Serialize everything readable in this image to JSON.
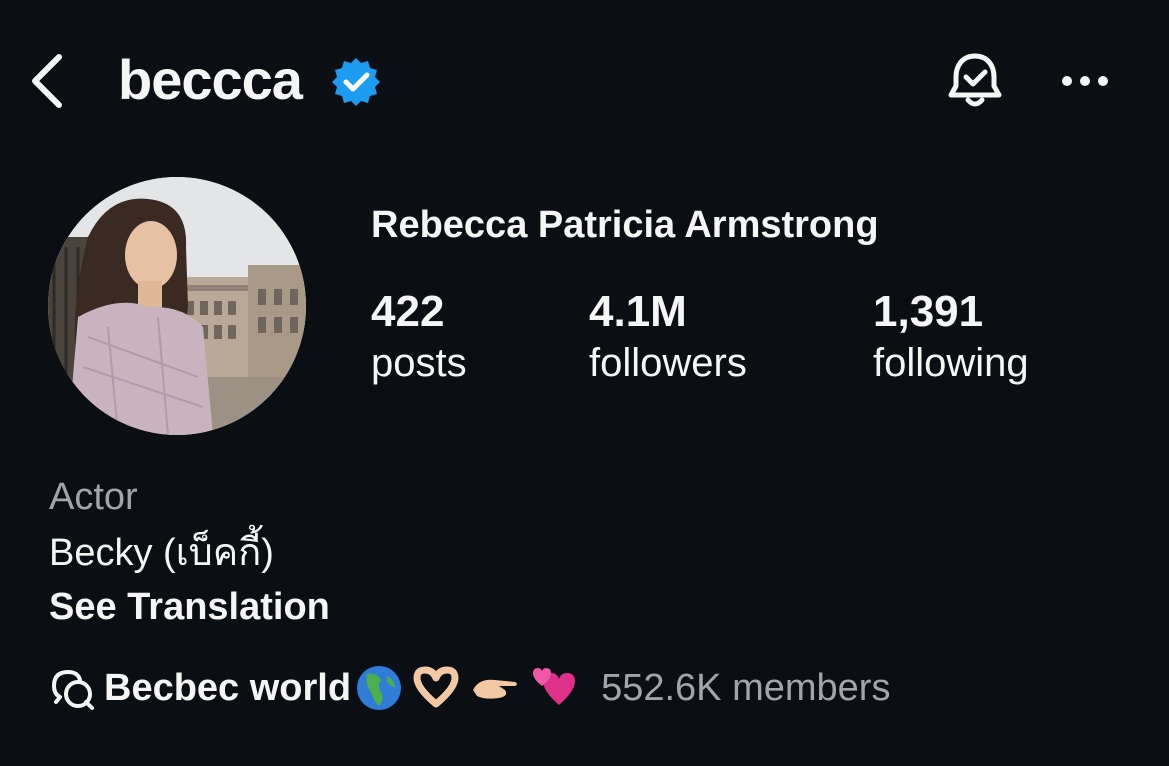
{
  "header": {
    "username": "beccca",
    "verified_color": "#1d9bf0"
  },
  "profile": {
    "full_name": "Rebecca Patricia Armstrong",
    "stats": [
      {
        "value": "422",
        "label": "posts"
      },
      {
        "value": "4.1M",
        "label": "followers"
      },
      {
        "value": "1,391",
        "label": "following"
      }
    ],
    "category": "Actor",
    "bio": "Becky (เบ็คกี้)",
    "see_translation": "See Translation"
  },
  "channel": {
    "name": "Becbec world",
    "emojis": [
      "globe-americas-emoji",
      "heart-hands-emoji",
      "pinching-hand-emoji",
      "two-hearts-emoji"
    ],
    "members": "552.6K members"
  },
  "colors": {
    "background": "#0b0f14",
    "text": "#f5f5f5",
    "muted": "#a0a4ab"
  }
}
